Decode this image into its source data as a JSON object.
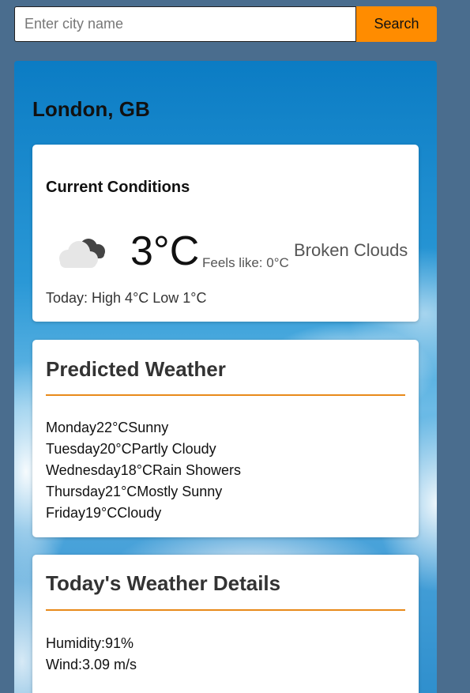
{
  "search": {
    "placeholder": "Enter city name",
    "value": "",
    "button_label": "Search",
    "button_color": "#ff8c00"
  },
  "location": {
    "city": "London, GB"
  },
  "current": {
    "title": "Current Conditions",
    "icon": "broken-clouds-icon",
    "temperature": "3°C",
    "feels_like": "Feels like: 0°C",
    "condition": "Broken Clouds",
    "today_range": "Today: High 4°C Low 1°C"
  },
  "predicted": {
    "title": "Predicted Weather",
    "days": [
      {
        "day": "Monday",
        "temp": "22°C",
        "condition": "Sunny"
      },
      {
        "day": "Tuesday",
        "temp": "20°C",
        "condition": "Partly Cloudy"
      },
      {
        "day": "Wednesday",
        "temp": "18°C",
        "condition": "Rain Showers"
      },
      {
        "day": "Thursday",
        "temp": "21°C",
        "condition": "Mostly Sunny"
      },
      {
        "day": "Friday",
        "temp": "19°C",
        "condition": "Cloudy"
      }
    ]
  },
  "details": {
    "title": "Today's Weather Details",
    "items": [
      {
        "label": "Humidity:",
        "value": "91%"
      },
      {
        "label": "Wind:",
        "value": "3.09 m/s"
      }
    ]
  },
  "colors": {
    "page_background": "#4a6d8e",
    "accent": "#e88a1a"
  }
}
